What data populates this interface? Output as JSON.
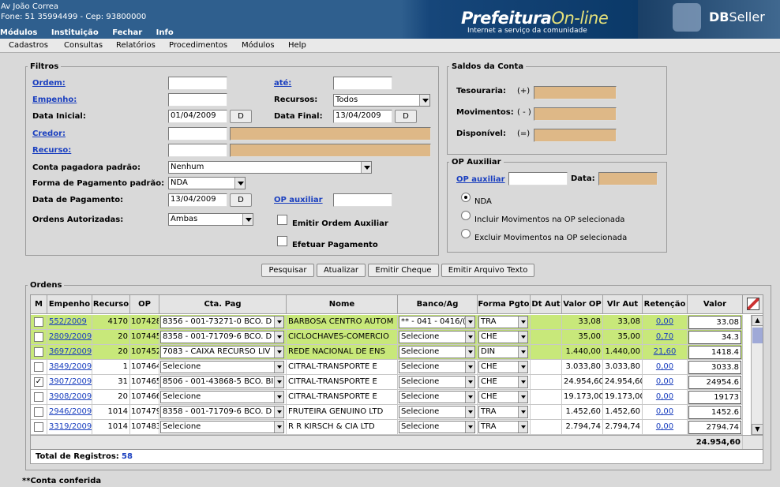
{
  "header": {
    "address": "Av João Correa",
    "contact": "Fone: 51 35994499  -  Cep: 93800000",
    "top_menu": [
      "Módulos",
      "Instituição",
      "Fechar",
      "Info"
    ],
    "brand_main": "Prefeitura",
    "brand_accent": "On-line",
    "brand_tagline": "Internet a serviço da comunidade",
    "vendor_a": "DB",
    "vendor_b": "Seller"
  },
  "menubar": [
    "Cadastros",
    "Consultas",
    "Relatórios",
    "Procedimentos",
    "Módulos",
    "Help"
  ],
  "filtros": {
    "legend": "Filtros",
    "ordem_label": "Ordem:",
    "ordem_value": "",
    "ate_label": "até:",
    "ate_value": "",
    "empenho_label": "Empenho:",
    "empenho_value": "",
    "recursos_label": "Recursos:",
    "recursos_value": "Todos",
    "data_inicial_label": "Data Inicial:",
    "data_inicial_value": "01/04/2009",
    "data_final_label": "Data Final:",
    "data_final_value": "13/04/2009",
    "date_btn": "D",
    "credor_label": "Credor:",
    "credor_value": "",
    "recurso_label": "Recurso:",
    "recurso_value": "",
    "conta_label": "Conta pagadora padrão:",
    "conta_value": "Nenhum",
    "forma_label": "Forma de Pagamento padrão:",
    "forma_value": "NDA",
    "data_pag_label": "Data de Pagamento:",
    "data_pag_value": "13/04/2009",
    "op_aux_label": "OP auxiliar",
    "op_aux_value": "",
    "ordens_aut_label": "Ordens Autorizadas:",
    "ordens_aut_value": "Ambas",
    "emitir_ordem_label": "Emitir Ordem Auxiliar",
    "efetuar_label": "Efetuar Pagamento"
  },
  "saldos": {
    "legend": "Saldos da Conta",
    "tesouraria_label": "Tesouraria:",
    "tesouraria_sign": "(+)",
    "movimentos_label": "Movimentos:",
    "movimentos_sign": "( - )",
    "disponivel_label": "Disponível:",
    "disponivel_sign": "(=)"
  },
  "op_auxiliar": {
    "legend": "OP Auxiliar",
    "op_label": "OP auxiliar",
    "op_value": "",
    "data_label": "Data:",
    "radios": [
      "NDA",
      "Incluir Movimentos na OP selecionada",
      "Excluir Movimentos na OP selecionada"
    ],
    "selected": 0
  },
  "actions": [
    "Pesquisar",
    "Atualizar",
    "Emitir Cheque",
    "Emitir Arquivo Texto"
  ],
  "ordens": {
    "legend": "Ordens",
    "columns": [
      "M",
      "Empenho",
      "Recurso",
      "OP",
      "Cta. Pag",
      "Nome",
      "Banco/Ag",
      "Forma Pgto",
      "Dt Aut",
      "Valor OP",
      "Vlr Aut",
      "Retenção",
      "Valor"
    ],
    "rows": [
      {
        "checked": false,
        "empenho": "552/2009",
        "recurso": "4170",
        "op": "107428",
        "cta": "8356 - 001-73271-0 BCO. D",
        "nome": "BARBOSA CENTRO AUTOM",
        "banco": "** - 041 - 0416/(",
        "forma": "TRA",
        "dtaut": "",
        "valor_op": "33,08",
        "vlr_aut": "33,08",
        "retencao": "0,00",
        "valor": "33.08",
        "highlight": true
      },
      {
        "checked": false,
        "empenho": "2809/2009",
        "recurso": "20",
        "op": "107445",
        "cta": "8358 - 001-71709-6 BCO. D",
        "nome": "CICLOCHAVES-COMERCIO",
        "banco": "Selecione",
        "forma": "CHE",
        "dtaut": "",
        "valor_op": "35,00",
        "vlr_aut": "35,00",
        "retencao": "0,70",
        "valor": "34.3",
        "highlight": true
      },
      {
        "checked": false,
        "empenho": "3697/2009",
        "recurso": "20",
        "op": "107452",
        "cta": "7083 - CAIXA RECURSO LIV",
        "nome": "REDE NACIONAL DE ENS",
        "banco": "Selecione",
        "forma": "DIN",
        "dtaut": "",
        "valor_op": "1.440,00",
        "vlr_aut": "1.440,00",
        "retencao": "21,60",
        "valor": "1418.4",
        "highlight": true
      },
      {
        "checked": false,
        "empenho": "3849/2009",
        "recurso": "1",
        "op": "107464",
        "cta": "Selecione",
        "nome": "CITRAL-TRANSPORTE E",
        "banco": "Selecione",
        "forma": "CHE",
        "dtaut": "",
        "valor_op": "3.033,80",
        "vlr_aut": "3.033,80",
        "retencao": "0,00",
        "valor": "3033.8",
        "highlight": false
      },
      {
        "checked": true,
        "empenho": "3907/2009",
        "recurso": "31",
        "op": "107465",
        "cta": "8506 - 001-43868-5 BCO. BI",
        "nome": "CITRAL-TRANSPORTE E",
        "banco": "Selecione",
        "forma": "CHE",
        "dtaut": "",
        "valor_op": "24.954,60",
        "vlr_aut": "24.954,60",
        "retencao": "0,00",
        "valor": "24954.6",
        "highlight": false
      },
      {
        "checked": false,
        "empenho": "3908/2009",
        "recurso": "20",
        "op": "107466",
        "cta": "Selecione",
        "nome": "CITRAL-TRANSPORTE E",
        "banco": "Selecione",
        "forma": "CHE",
        "dtaut": "",
        "valor_op": "19.173,00",
        "vlr_aut": "19.173,00",
        "retencao": "0,00",
        "valor": "19173",
        "highlight": false
      },
      {
        "checked": false,
        "empenho": "2946/2009",
        "recurso": "1014",
        "op": "107479",
        "cta": "8358 - 001-71709-6 BCO. D",
        "nome": "FRUTEIRA GENUINO LTD",
        "banco": "Selecione",
        "forma": "TRA",
        "dtaut": "",
        "valor_op": "1.452,60",
        "vlr_aut": "1.452,60",
        "retencao": "0,00",
        "valor": "1452.6",
        "highlight": false
      },
      {
        "checked": false,
        "empenho": "3319/2009",
        "recurso": "1014",
        "op": "107483",
        "cta": "Selecione",
        "nome": "R R KIRSCH & CIA LTD",
        "banco": "Selecione",
        "forma": "TRA",
        "dtaut": "",
        "valor_op": "2.794,74",
        "vlr_aut": "2.794,74",
        "retencao": "0,00",
        "valor": "2794.74",
        "highlight": false
      }
    ],
    "footer_total": "24.954,60",
    "total_label": "Total de Registros:",
    "total_count": "58"
  },
  "footnote": "**Conta conferida",
  "colors": {
    "highlight_row": "#c8e87a",
    "readonly_field": "#deb887",
    "link": "#1a3fbf",
    "header_blue": "#2f5f8e"
  }
}
